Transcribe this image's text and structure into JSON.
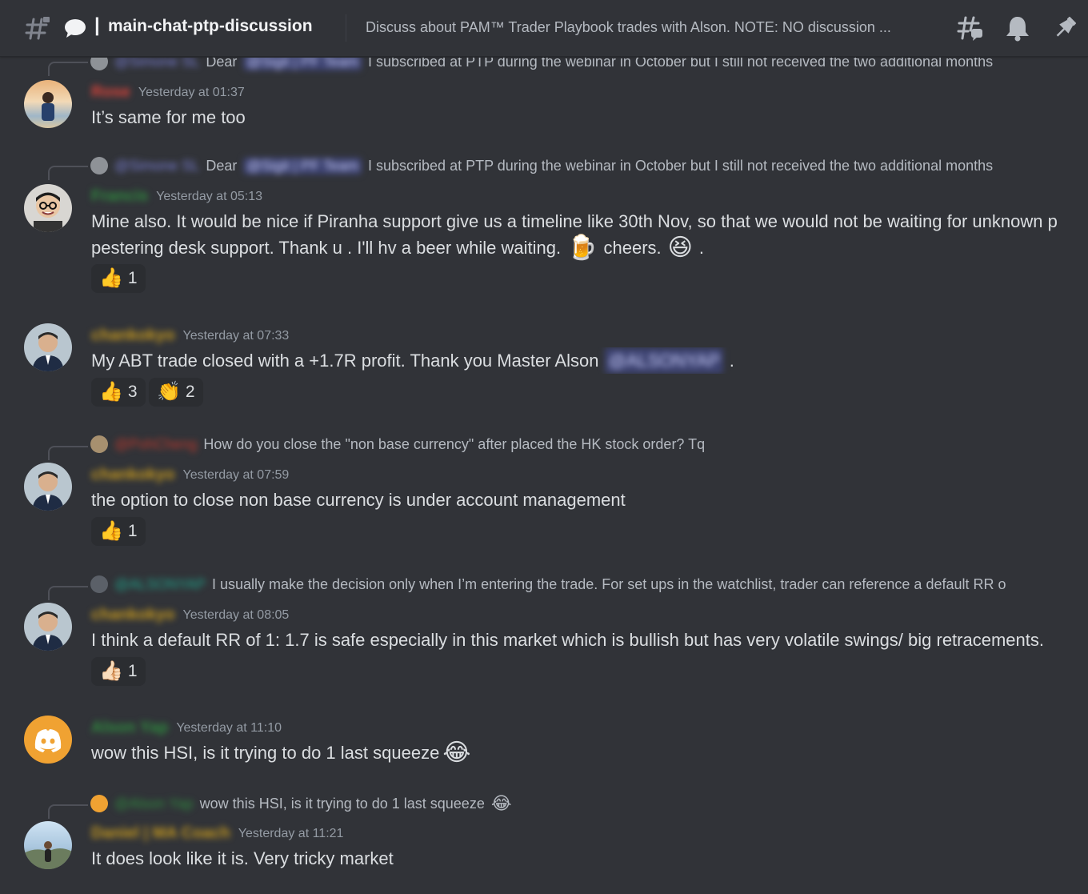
{
  "header": {
    "channel_name": "main-chat-ptp-discussion",
    "topic": "Discuss about PAM™ Trader Playbook trades with Alson. NOTE: NO discussion ..."
  },
  "messages": [
    {
      "reply": {
        "author": "@Simone SL",
        "text_prefix": "Dear",
        "mention": "@Sigit | PF Team",
        "text": "I subscribed at PTP during the webinar in October but I still not received the two additional months"
      },
      "author": "Rose",
      "time": "Yesterday at 01:37",
      "text": "It’s same for me too"
    },
    {
      "reply": {
        "author": "@Simone SL",
        "text_prefix": "Dear",
        "mention": "@Sigit | PF Team",
        "text": "I subscribed at PTP during the webinar in October but I still not received the two additional months"
      },
      "author": "Francis",
      "time": "Yesterday at 05:13",
      "text_line1": "Mine also. It would be nice if Piranha support give us a timeline like 30th Nov, so that we would not be waiting for unknown p",
      "text_line2": "pestering desk support. Thank u . I'll hv a beer while waiting.",
      "text_line2_b": "cheers.",
      "text_line2_c": ".",
      "reactions": [
        {
          "emoji": "👍",
          "count": "1"
        }
      ]
    },
    {
      "author": "chankokyo",
      "time": "Yesterday at 07:33",
      "text": "My ABT trade closed with a +1.7R profit. Thank you Master Alson",
      "mention": "@ALSONYAP",
      "text_end": ".",
      "reactions": [
        {
          "emoji": "👍",
          "count": "3"
        },
        {
          "emoji": "👏",
          "count": "2"
        }
      ]
    },
    {
      "reply": {
        "author": "@PohCheng",
        "text": "How do you close the \"non base currency\" after placed the HK stock order? Tq"
      },
      "author": "chankokyo",
      "time": "Yesterday at 07:59",
      "text": "the option to close non base currency is under account management",
      "reactions": [
        {
          "emoji": "👍",
          "count": "1"
        }
      ]
    },
    {
      "reply": {
        "author": "@ALSONYAP",
        "text": "I usually make the decision only when I’m entering the trade. For set ups in the watchlist, trader can reference a default RR o"
      },
      "author": "chankokyo",
      "time": "Yesterday at 08:05",
      "text": "I think a default RR of 1: 1.7 is safe especially in this market which is bullish but has very volatile swings/ big retracements.",
      "reactions": [
        {
          "emoji": "👍🏻",
          "count": "1"
        }
      ]
    },
    {
      "author": "Alson Yap",
      "time": "Yesterday at 11:10",
      "text": "wow this HSI, is it trying to do 1 last squeeze"
    },
    {
      "reply": {
        "author": "@Alson Yap",
        "text": "wow this HSI, is it trying to do 1 last squeeze"
      },
      "author": "Daniel | MA Coach",
      "time": "Yesterday at 11:21",
      "text": "It does look like it is. Very tricky market"
    }
  ]
}
